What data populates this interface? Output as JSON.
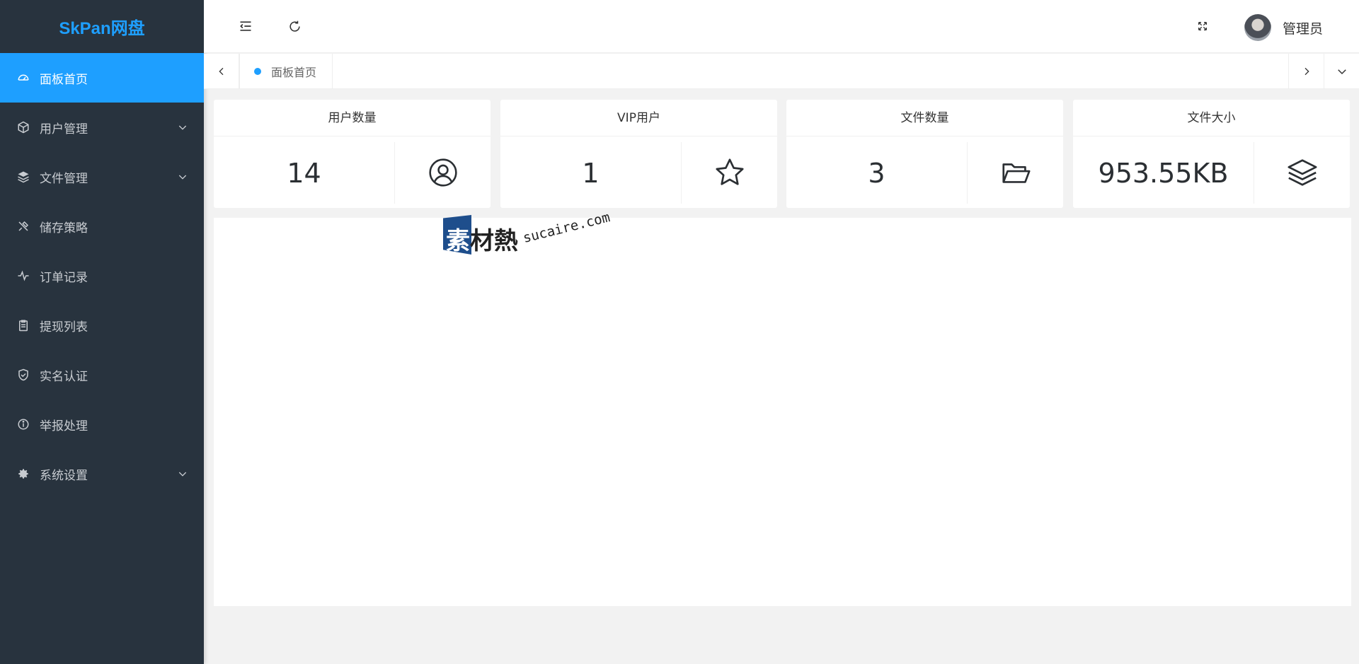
{
  "app": {
    "logo": "SkPan网盘"
  },
  "sidebar": {
    "items": [
      {
        "label": "面板首页",
        "icon": "dashboard-icon",
        "active": true,
        "expandable": false
      },
      {
        "label": "用户管理",
        "icon": "cube-icon",
        "active": false,
        "expandable": true
      },
      {
        "label": "文件管理",
        "icon": "layers-icon",
        "active": false,
        "expandable": true
      },
      {
        "label": "储存策略",
        "icon": "tools-icon",
        "active": false,
        "expandable": false
      },
      {
        "label": "订单记录",
        "icon": "pulse-icon",
        "active": false,
        "expandable": false
      },
      {
        "label": "提现列表",
        "icon": "clipboard-icon",
        "active": false,
        "expandable": false
      },
      {
        "label": "实名认证",
        "icon": "shield-check-icon",
        "active": false,
        "expandable": false
      },
      {
        "label": "举报处理",
        "icon": "info-icon",
        "active": false,
        "expandable": false
      },
      {
        "label": "系统设置",
        "icon": "gear-icon",
        "active": false,
        "expandable": true
      }
    ]
  },
  "header": {
    "user": {
      "name": "管理员"
    }
  },
  "tabs": [
    {
      "label": "面板首页",
      "active": true
    }
  ],
  "cards": [
    {
      "title": "用户数量",
      "value": "14",
      "icon": "user-circle-icon"
    },
    {
      "title": "VIP用户",
      "value": "1",
      "icon": "star-icon"
    },
    {
      "title": "文件数量",
      "value": "3",
      "icon": "folder-open-icon"
    },
    {
      "title": "文件大小",
      "value": "953.55KB",
      "icon": "layers-icon"
    }
  ],
  "watermark": {
    "cn_first": "素",
    "cn_rest": "材熱",
    "en": "sucaire.com"
  },
  "colors": {
    "accent": "#1e9fff",
    "sidebar_bg": "#28333e",
    "page_bg": "#f2f2f2",
    "watermark_box": "#1e4e8c"
  }
}
